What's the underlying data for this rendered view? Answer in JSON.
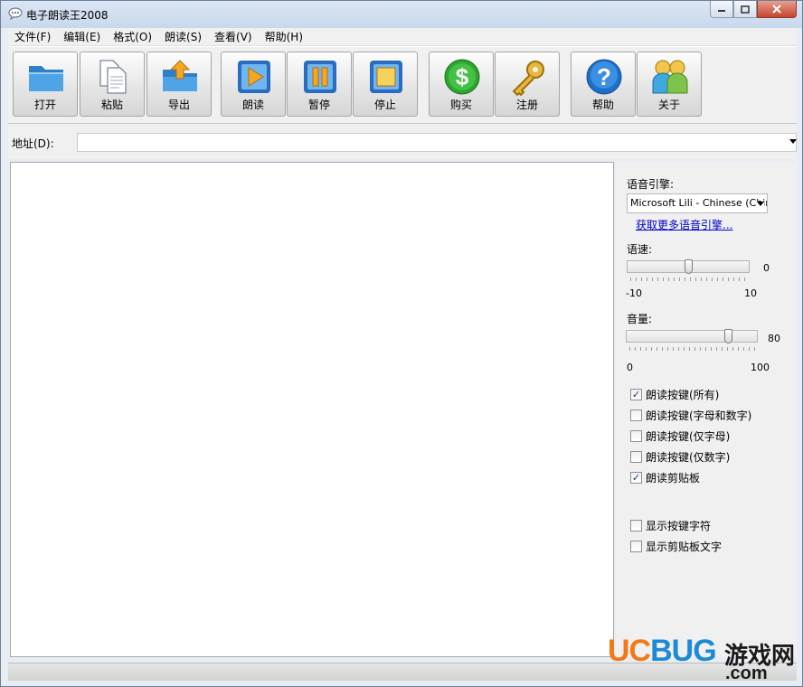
{
  "window": {
    "title": "电子朗读王2008"
  },
  "menu": [
    "文件(F)",
    "编辑(E)",
    "格式(O)",
    "朗读(S)",
    "查看(V)",
    "帮助(H)"
  ],
  "toolbar": {
    "open": "打开",
    "paste": "粘贴",
    "export": "导出",
    "read": "朗读",
    "pause": "暂停",
    "stop": "停止",
    "buy": "购买",
    "register": "注册",
    "help": "帮助",
    "about": "关于"
  },
  "address": {
    "label": "地址(D):",
    "value": ""
  },
  "panel": {
    "engine_label": "语音引擎:",
    "engine_value": "Microsoft Lili - Chinese (China)",
    "more_engines_link": "获取更多语音引擎...",
    "speed_label": "语速:",
    "speed_value": "0",
    "speed_min": "-10",
    "speed_max": "10",
    "speed_level": 0,
    "volume_label": "音量:",
    "volume_value": "80",
    "volume_min": "0",
    "volume_max": "100",
    "volume_level": 80,
    "checkboxes": [
      {
        "label": "朗读按键(所有)",
        "checked": true
      },
      {
        "label": "朗读按键(字母和数字)",
        "checked": false
      },
      {
        "label": "朗读按键(仅字母)",
        "checked": false
      },
      {
        "label": "朗读按键(仅数字)",
        "checked": false
      },
      {
        "label": "朗读剪贴板",
        "checked": true
      }
    ],
    "checkboxes2": [
      {
        "label": "显示按键字符",
        "checked": false
      },
      {
        "label": "显示剪贴板文字",
        "checked": false
      }
    ]
  },
  "watermark": {
    "brand": "UCBUG",
    "cn": "游戏网",
    "domain": ".com"
  },
  "colors": {
    "accent_blue": "#1e73c8",
    "watermark_orange": "#f07a1a",
    "watermark_blue": "#1e8ad6",
    "buy_green": "#2ea52e",
    "register_gold": "#d9a62a"
  }
}
